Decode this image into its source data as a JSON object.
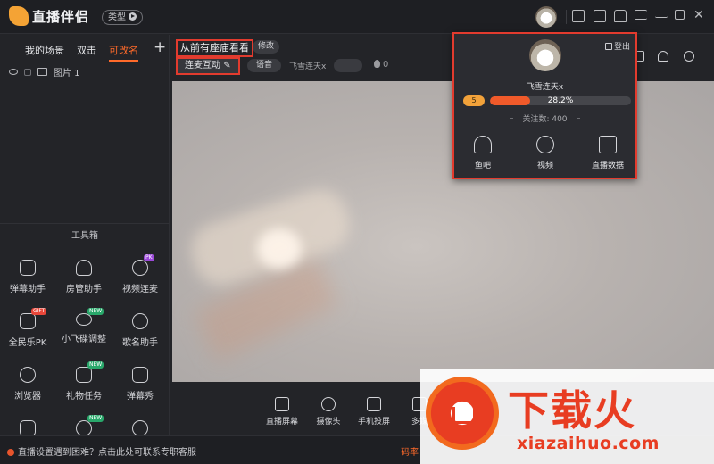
{
  "app": {
    "name": "直播伴侣",
    "type_label": "类型"
  },
  "sidebar": {
    "scene_tabs": [
      "我的场景",
      "双击",
      "可改名"
    ],
    "add_label": "+",
    "layers": [
      {
        "name": "图片 1"
      }
    ],
    "toolbox_title": "工具箱",
    "tools": [
      {
        "label": "弹幕助手",
        "icon": "danmaku-icon",
        "badge": ""
      },
      {
        "label": "房管助手",
        "icon": "room-manager-icon",
        "badge": ""
      },
      {
        "label": "视频连麦",
        "icon": "video-mic-icon",
        "badge": "PK"
      },
      {
        "label": "全民乐PK",
        "icon": "pk-icon",
        "badge": "GIFT"
      },
      {
        "label": "小飞碟调整",
        "icon": "ufo-icon",
        "badge": "NEW"
      },
      {
        "label": "歌名助手",
        "icon": "music-icon",
        "badge": ""
      },
      {
        "label": "浏览器",
        "icon": "browser-icon",
        "badge": ""
      },
      {
        "label": "礼物任务",
        "icon": "gift-task-icon",
        "badge": "NEW"
      },
      {
        "label": "弹幕秀",
        "icon": "danmaku-show-icon",
        "badge": ""
      }
    ]
  },
  "header": {
    "room_title": "从前有座庙看看",
    "modify_label": "修改",
    "interact_label": "连麦互动",
    "voice_label": "语音",
    "host_name": "飞雪连天x",
    "popularity": "0"
  },
  "controls": [
    {
      "label": "直播屏幕",
      "icon": "screen-icon"
    },
    {
      "label": "摄像头",
      "icon": "camera-icon"
    },
    {
      "label": "手机投屏",
      "icon": "phone-cast-icon"
    },
    {
      "label": "多媒",
      "icon": "media-icon"
    }
  ],
  "status": {
    "help_text": "直播设置遇到困难？点击此处可联系专职客服",
    "bitrate_label": "码率"
  },
  "profile": {
    "logout_label": "登出",
    "name": "飞雪连天x",
    "level": "5",
    "progress": 28.2,
    "progress_text": "28.2%",
    "followers_text": "关注数: 400",
    "items": [
      {
        "label": "鱼吧",
        "icon": "fishbar-icon"
      },
      {
        "label": "视频",
        "icon": "video-icon"
      },
      {
        "label": "直播数据",
        "icon": "live-data-icon"
      }
    ]
  },
  "watermark": {
    "cn": "下载火",
    "en": "xiazaihuo.com"
  },
  "colors": {
    "accent": "#ff6a2a",
    "highlight_border": "#e23b2e",
    "background": "#232428"
  }
}
